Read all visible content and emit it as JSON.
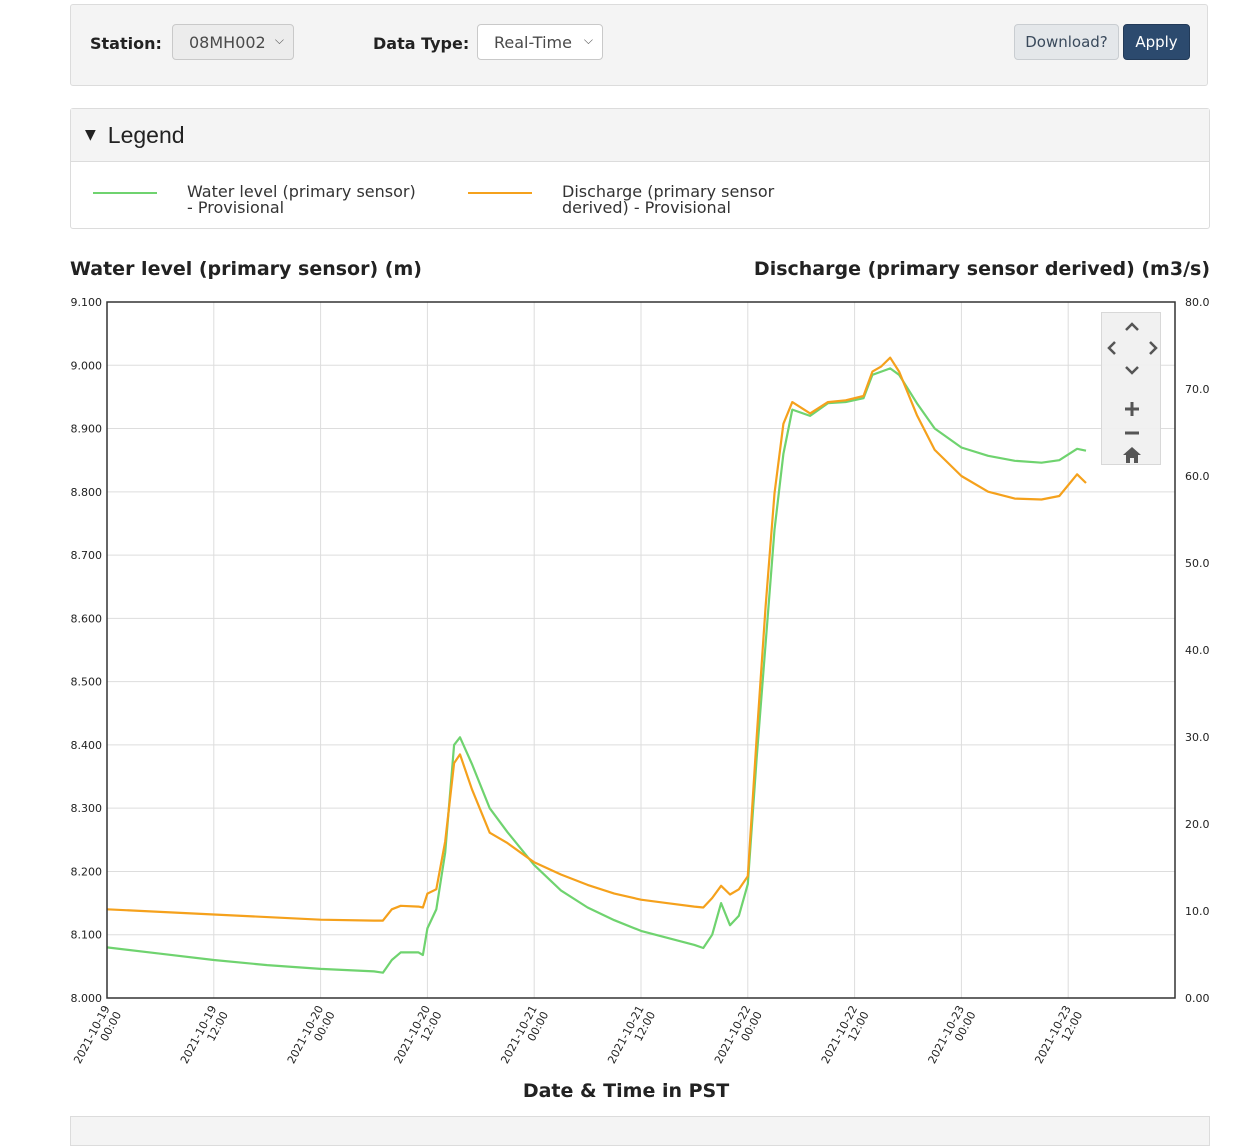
{
  "filters": {
    "station_label": "Station:",
    "station_value": "08MH002",
    "data_type_label": "Data Type:",
    "data_type_value": "Real-Time",
    "download_label": "Download?",
    "apply_label": "Apply"
  },
  "legend": {
    "title": "Legend",
    "items": [
      {
        "label": "Water level (primary sensor) - Provisional",
        "color": "#6fd36f"
      },
      {
        "label": "Discharge (primary sensor derived) - Provisional",
        "color": "#f5a11c"
      }
    ]
  },
  "chart_data": {
    "type": "line",
    "left_axis_title": "Water level (primary sensor) (m)",
    "right_axis_title": "Discharge (primary sensor derived) (m3/s)",
    "xlabel": "Date & Time in PST",
    "x_ticks": [
      [
        "2021-10-19",
        "00:00"
      ],
      [
        "2021-10-19",
        "12:00"
      ],
      [
        "2021-10-20",
        "00:00"
      ],
      [
        "2021-10-20",
        "12:00"
      ],
      [
        "2021-10-21",
        "00:00"
      ],
      [
        "2021-10-21",
        "12:00"
      ],
      [
        "2021-10-22",
        "00:00"
      ],
      [
        "2021-10-22",
        "12:00"
      ],
      [
        "2021-10-23",
        "00:00"
      ],
      [
        "2021-10-23",
        "12:00"
      ]
    ],
    "xlim": [
      "2021-10-19 00:00",
      "2021-10-24 00:00"
    ],
    "left_ylim": [
      8.0,
      9.1
    ],
    "left_yticks": [
      "8.000",
      "8.100",
      "8.200",
      "8.300",
      "8.400",
      "8.500",
      "8.600",
      "8.700",
      "8.800",
      "8.900",
      "9.000",
      "9.100"
    ],
    "right_ylim": [
      0.0,
      80.0
    ],
    "right_yticks": [
      "0.00",
      "10.0",
      "20.0",
      "30.0",
      "40.0",
      "50.0",
      "60.0",
      "70.0",
      "80.0"
    ],
    "grid": true,
    "series": [
      {
        "name": "Water level (primary sensor) - Provisional",
        "axis": "left",
        "color": "#6fd36f",
        "points": [
          [
            "2021-10-19 00:00",
            8.08
          ],
          [
            "2021-10-19 06:00",
            8.07
          ],
          [
            "2021-10-19 12:00",
            8.06
          ],
          [
            "2021-10-19 18:00",
            8.052
          ],
          [
            "2021-10-20 00:00",
            8.046
          ],
          [
            "2021-10-20 06:00",
            8.042
          ],
          [
            "2021-10-20 07:00",
            8.04
          ],
          [
            "2021-10-20 08:00",
            8.06
          ],
          [
            "2021-10-20 09:00",
            8.072
          ],
          [
            "2021-10-20 11:00",
            8.072
          ],
          [
            "2021-10-20 11:30",
            8.068
          ],
          [
            "2021-10-20 12:00",
            8.11
          ],
          [
            "2021-10-20 13:00",
            8.14
          ],
          [
            "2021-10-20 14:00",
            8.23
          ],
          [
            "2021-10-20 15:00",
            8.4
          ],
          [
            "2021-10-20 15:40",
            8.412
          ],
          [
            "2021-10-20 17:00",
            8.37
          ],
          [
            "2021-10-20 19:00",
            8.3
          ],
          [
            "2021-10-20 21:00",
            8.262
          ],
          [
            "2021-10-21 00:00",
            8.21
          ],
          [
            "2021-10-21 03:00",
            8.17
          ],
          [
            "2021-10-21 06:00",
            8.143
          ],
          [
            "2021-10-21 09:00",
            8.123
          ],
          [
            "2021-10-21 12:00",
            8.106
          ],
          [
            "2021-10-21 15:00",
            8.095
          ],
          [
            "2021-10-21 18:00",
            8.084
          ],
          [
            "2021-10-21 19:00",
            8.079
          ],
          [
            "2021-10-21 20:00",
            8.1
          ],
          [
            "2021-10-21 21:00",
            8.15
          ],
          [
            "2021-10-21 22:00",
            8.115
          ],
          [
            "2021-10-21 23:00",
            8.13
          ],
          [
            "2021-10-22 00:00",
            8.18
          ],
          [
            "2021-10-22 01:00",
            8.38
          ],
          [
            "2021-10-22 02:00",
            8.56
          ],
          [
            "2021-10-22 03:00",
            8.74
          ],
          [
            "2021-10-22 04:00",
            8.86
          ],
          [
            "2021-10-22 05:00",
            8.93
          ],
          [
            "2021-10-22 07:00",
            8.92
          ],
          [
            "2021-10-22 09:00",
            8.94
          ],
          [
            "2021-10-22 11:00",
            8.942
          ],
          [
            "2021-10-22 13:00",
            8.948
          ],
          [
            "2021-10-22 14:00",
            8.985
          ],
          [
            "2021-10-22 15:00",
            8.99
          ],
          [
            "2021-10-22 16:00",
            8.995
          ],
          [
            "2021-10-22 17:00",
            8.985
          ],
          [
            "2021-10-22 19:00",
            8.94
          ],
          [
            "2021-10-22 21:00",
            8.9
          ],
          [
            "2021-10-23 00:00",
            8.87
          ],
          [
            "2021-10-23 03:00",
            8.857
          ],
          [
            "2021-10-23 06:00",
            8.849
          ],
          [
            "2021-10-23 09:00",
            8.846
          ],
          [
            "2021-10-23 11:00",
            8.85
          ],
          [
            "2021-10-23 13:00",
            8.868
          ],
          [
            "2021-10-23 14:00",
            8.865
          ]
        ]
      },
      {
        "name": "Discharge (primary sensor derived) - Provisional",
        "axis": "right",
        "color": "#f5a11c",
        "points": [
          [
            "2021-10-19 00:00",
            10.2
          ],
          [
            "2021-10-19 12:00",
            9.6
          ],
          [
            "2021-10-20 00:00",
            9.0
          ],
          [
            "2021-10-20 06:00",
            8.9
          ],
          [
            "2021-10-20 07:00",
            8.9
          ],
          [
            "2021-10-20 08:00",
            10.2
          ],
          [
            "2021-10-20 09:00",
            10.6
          ],
          [
            "2021-10-20 11:00",
            10.5
          ],
          [
            "2021-10-20 11:30",
            10.4
          ],
          [
            "2021-10-20 12:00",
            12.0
          ],
          [
            "2021-10-20 13:00",
            12.5
          ],
          [
            "2021-10-20 14:00",
            18.0
          ],
          [
            "2021-10-20 15:00",
            27.0
          ],
          [
            "2021-10-20 15:40",
            28.0
          ],
          [
            "2021-10-20 17:00",
            24.0
          ],
          [
            "2021-10-20 19:00",
            19.0
          ],
          [
            "2021-10-20 21:00",
            17.8
          ],
          [
            "2021-10-21 00:00",
            15.6
          ],
          [
            "2021-10-21 03:00",
            14.2
          ],
          [
            "2021-10-21 06:00",
            13.0
          ],
          [
            "2021-10-21 09:00",
            12.0
          ],
          [
            "2021-10-21 12:00",
            11.3
          ],
          [
            "2021-10-21 15:00",
            10.9
          ],
          [
            "2021-10-21 18:00",
            10.5
          ],
          [
            "2021-10-21 19:00",
            10.4
          ],
          [
            "2021-10-21 20:00",
            11.5
          ],
          [
            "2021-10-21 21:00",
            12.9
          ],
          [
            "2021-10-21 22:00",
            11.9
          ],
          [
            "2021-10-21 23:00",
            12.5
          ],
          [
            "2021-10-22 00:00",
            14.0
          ],
          [
            "2021-10-22 01:00",
            30.0
          ],
          [
            "2021-10-22 02:00",
            45.0
          ],
          [
            "2021-10-22 03:00",
            58.0
          ],
          [
            "2021-10-22 04:00",
            66.0
          ],
          [
            "2021-10-22 05:00",
            68.5
          ],
          [
            "2021-10-22 07:00",
            67.2
          ],
          [
            "2021-10-22 09:00",
            68.5
          ],
          [
            "2021-10-22 11:00",
            68.7
          ],
          [
            "2021-10-22 13:00",
            69.2
          ],
          [
            "2021-10-22 14:00",
            72.0
          ],
          [
            "2021-10-22 15:00",
            72.6
          ],
          [
            "2021-10-22 16:00",
            73.6
          ],
          [
            "2021-10-22 17:00",
            72.0
          ],
          [
            "2021-10-22 19:00",
            67.0
          ],
          [
            "2021-10-22 21:00",
            63.0
          ],
          [
            "2021-10-23 00:00",
            60.0
          ],
          [
            "2021-10-23 03:00",
            58.2
          ],
          [
            "2021-10-23 06:00",
            57.4
          ],
          [
            "2021-10-23 09:00",
            57.3
          ],
          [
            "2021-10-23 11:00",
            57.7
          ],
          [
            "2021-10-23 13:00",
            60.2
          ],
          [
            "2021-10-23 14:00",
            59.2
          ]
        ]
      }
    ]
  },
  "nav_controls": {
    "icons": [
      "chevron-up-icon",
      "chevron-left-icon",
      "chevron-right-icon",
      "chevron-down-icon",
      "zoom-in-icon",
      "zoom-out-icon",
      "home-icon"
    ]
  }
}
